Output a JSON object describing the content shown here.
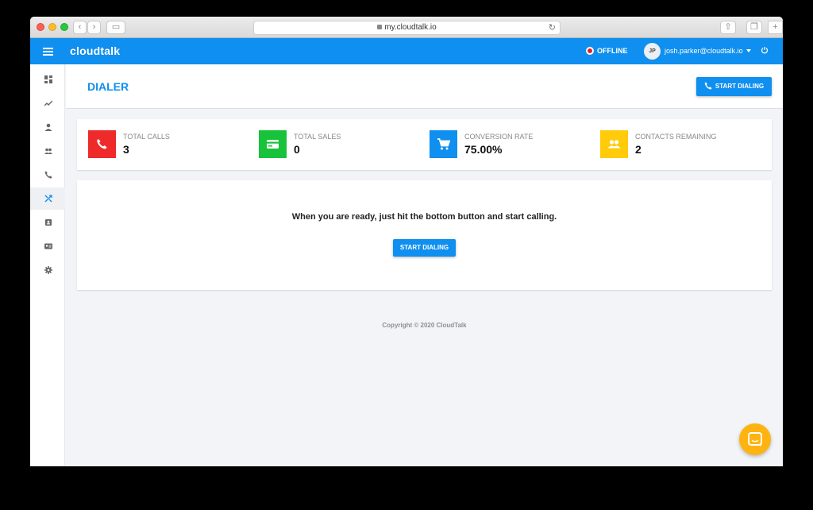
{
  "browser": {
    "url": "my.cloudtalk.io"
  },
  "header": {
    "logo": "cloudtalk",
    "status": "OFFLINE",
    "user_initials": "JP",
    "user_email": "josh.parker@cloudtalk.io"
  },
  "sidebar": {
    "items": [
      {
        "icon": "dashboard-icon",
        "active": false
      },
      {
        "icon": "trending-icon",
        "active": false
      },
      {
        "icon": "person-icon",
        "active": false
      },
      {
        "icon": "people-icon",
        "active": false
      },
      {
        "icon": "phone-icon",
        "active": false
      },
      {
        "icon": "shuffle-icon",
        "active": true
      },
      {
        "icon": "contacts-book-icon",
        "active": false
      },
      {
        "icon": "contact-card-icon",
        "active": false
      },
      {
        "icon": "settings-icon",
        "active": false
      }
    ]
  },
  "page": {
    "title": "DIALER",
    "start_button": "START DIALING"
  },
  "stats": [
    {
      "label": "TOTAL CALLS",
      "value": "3",
      "color": "#ee2a2a",
      "icon": "phone-icon"
    },
    {
      "label": "TOTAL SALES",
      "value": "0",
      "color": "#18c23a",
      "icon": "card-icon"
    },
    {
      "label": "CONVERSION RATE",
      "value": "75.00%",
      "color": "#0f8fef",
      "icon": "cart-icon"
    },
    {
      "label": "CONTACTS REMAINING",
      "value": "2",
      "color": "#ffcb0a",
      "icon": "group-icon"
    }
  ],
  "panel": {
    "message": "When you are ready, just hit the bottom button and start calling.",
    "button": "START DIALING"
  },
  "footer": {
    "copyright": "Copyright © 2020 CloudTalk"
  },
  "colors": {
    "primary": "#0f8fef",
    "chat": "#ffb310"
  }
}
